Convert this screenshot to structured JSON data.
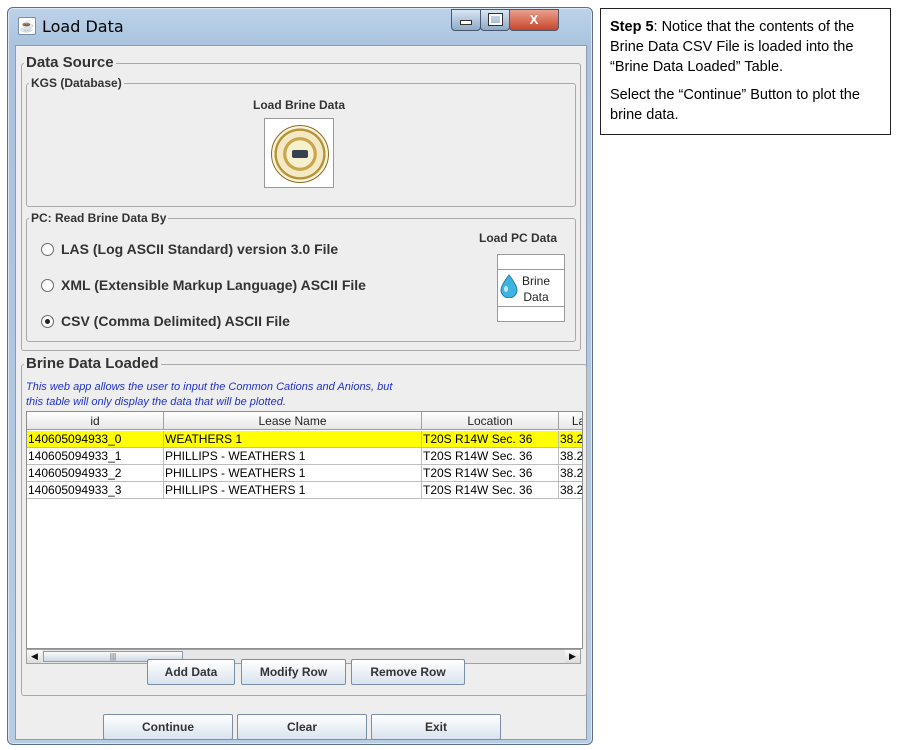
{
  "window": {
    "title": "Load Data",
    "app_icon": "java-coffee-icon",
    "controls": {
      "minimize": "minimize-icon",
      "maximize": "maximize-icon",
      "close_glyph": "X"
    }
  },
  "data_source": {
    "title": "Data Source",
    "kgs": {
      "title": "KGS (Database)",
      "load_label": "Load Brine Data",
      "button_icon": "kgs-seal-icon"
    },
    "pc": {
      "title": "PC: Read Brine Data By",
      "options": [
        {
          "label": "LAS (Log ASCII Standard) version 3.0 File",
          "checked": false
        },
        {
          "label": "XML (Extensible Markup Language) ASCII File",
          "checked": false
        },
        {
          "label": "CSV (Comma Delimited) ASCII File",
          "checked": true
        }
      ],
      "load_label": "Load PC Data",
      "button_line1": "Brine",
      "button_line2": "Data",
      "button_icon": "water-drop-icon"
    }
  },
  "brine_loaded": {
    "title": "Brine Data Loaded",
    "note_line1": "This web app allows the user to input the Common Cations and Anions, but",
    "note_line2": "this table will only display the data that will be plotted.",
    "columns": [
      "id",
      "Lease Name",
      "Location",
      "La"
    ],
    "rows": [
      [
        "140605094933_0",
        "WEATHERS 1",
        "T20S R14W Sec. 36",
        "38.2"
      ],
      [
        "140605094933_1",
        "PHILLIPS - WEATHERS 1",
        "T20S R14W Sec. 36",
        "38.2"
      ],
      [
        "140605094933_2",
        "PHILLIPS - WEATHERS 1",
        "T20S R14W Sec. 36",
        "38.2"
      ],
      [
        "140605094933_3",
        "PHILLIPS - WEATHERS 1",
        "T20S R14W Sec. 36",
        "38.2"
      ]
    ],
    "selected_row": 0,
    "scroll": {
      "left_arrow": "◀",
      "right_arrow": "▶",
      "thumb_grip": "|||"
    },
    "buttons": {
      "add": "Add Data",
      "modify": "Modify Row",
      "remove": "Remove Row"
    }
  },
  "footer": {
    "continue": "Continue",
    "clear": "Clear",
    "exit": "Exit"
  },
  "callout": {
    "step_label": "Step 5",
    "step_text": ": Notice that the contents of the Brine Data CSV File is loaded into the “Brine Data Loaded” Table.",
    "instruction": "Select the “Continue” Button to plot the brine data."
  },
  "colors": {
    "selected_row": "#ffff00",
    "note_text": "#2233cc",
    "window_frame": "#a9c2dd"
  }
}
